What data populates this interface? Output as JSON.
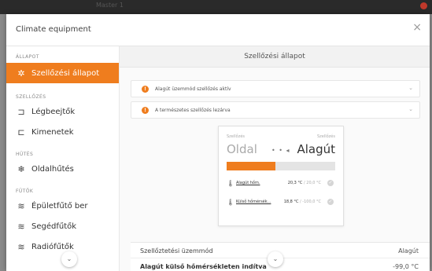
{
  "window": {
    "title": "Master 1"
  },
  "dialog": {
    "title": "Climate equipment",
    "close": "×"
  },
  "sidebar": {
    "sections": [
      {
        "label": "ÁLLAPOT",
        "items": [
          {
            "label": "Szellőzési állapot",
            "icon": "ventilation-icon",
            "glyph": "✲",
            "active": true
          }
        ]
      },
      {
        "label": "SZELLŐZÉS",
        "items": [
          {
            "label": "Légbeejtők",
            "icon": "air-inlet-icon",
            "glyph": "⊐"
          },
          {
            "label": "Kimenetek",
            "icon": "outlet-icon",
            "glyph": "⊏"
          }
        ]
      },
      {
        "label": "HŰTÉS",
        "items": [
          {
            "label": "Oldalhűtés",
            "icon": "cooling-icon",
            "glyph": "❄"
          }
        ]
      },
      {
        "label": "FŰTŐK",
        "items": [
          {
            "label": "Épületfűtő ber",
            "icon": "heater-icon",
            "glyph": "≋"
          },
          {
            "label": "Segédfűtők",
            "icon": "aux-heater-icon",
            "glyph": "≋"
          },
          {
            "label": "Radiófűtők",
            "icon": "radiant-heater-icon",
            "glyph": "≋"
          }
        ]
      }
    ]
  },
  "main": {
    "title": "Szellőzési állapot",
    "notices": [
      {
        "text": "Alagút üzemmód szellőzés aktív"
      },
      {
        "text": "A természetes szellőzés lezárva"
      }
    ],
    "card": {
      "left_label": "Szellőzés",
      "left_value": "Oldal",
      "right_label": "Szellőzés",
      "right_value": "Alagút",
      "arrows": "• • ◂",
      "progress": 0.45,
      "rows": [
        {
          "name": "Alagút hőm.",
          "value": "20,3 °C",
          "target": " / 20,0 °C"
        },
        {
          "name": "Külső hőmérsék...",
          "value": "18,8 °C",
          "target": " / -100,0 °C"
        }
      ]
    },
    "settings": [
      {
        "key": "Szellőztetési üzemmód",
        "value": "Alagút"
      },
      {
        "key": "Alagút külső hőmérsékleten indítva",
        "value": "-99,0 °C"
      }
    ]
  },
  "colors": {
    "accent": "#ef7d1e",
    "background": "#ffffff"
  }
}
